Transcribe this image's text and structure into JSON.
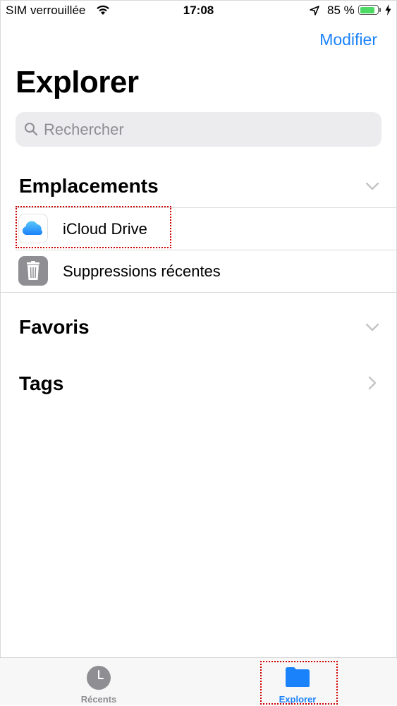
{
  "status_bar": {
    "carrier": "SIM verrouillée",
    "time": "17:08",
    "battery_percent": "85 %",
    "battery_level": 0.85
  },
  "nav": {
    "edit_label": "Modifier",
    "title": "Explorer"
  },
  "search": {
    "placeholder": "Rechercher"
  },
  "sections": {
    "locations": {
      "title": "Emplacements",
      "items": [
        {
          "label": "iCloud Drive",
          "icon": "icloud-icon"
        },
        {
          "label": "Suppressions récentes",
          "icon": "trash-icon"
        }
      ]
    },
    "favorites": {
      "title": "Favoris"
    },
    "tags": {
      "title": "Tags"
    }
  },
  "tab_bar": {
    "tabs": [
      {
        "label": "Récents",
        "icon": "clock-icon",
        "active": false
      },
      {
        "label": "Explorer",
        "icon": "folder-icon",
        "active": true
      }
    ]
  },
  "colors": {
    "accent": "#1a82fb",
    "inactive_tab": "#8e8e93",
    "annotation": "#d00000"
  }
}
